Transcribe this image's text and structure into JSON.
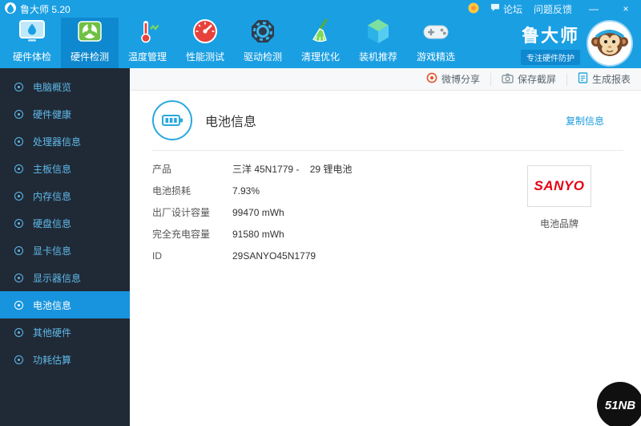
{
  "colors": {
    "accent_blue": "#1a9fe3",
    "nav_active_blue": "#0e88cf",
    "sidebar_bg": "#202a37",
    "sidebar_active_blue": "#1794dd",
    "link_blue": "#1a9bdf",
    "sanyo_red": "#e60012"
  },
  "titlebar": {
    "app_title": "鲁大师 5.20",
    "forum_label": "论坛",
    "feedback_label": "问题反馈",
    "minimize_glyph": "—",
    "close_glyph": "×"
  },
  "nav": {
    "items": [
      {
        "label": "硬件体检",
        "icon": "monitor-drop-icon",
        "active": false
      },
      {
        "label": "硬件检测",
        "icon": "gpu-fan-icon",
        "active": true
      },
      {
        "label": "温度管理",
        "icon": "thermometer-icon",
        "active": false
      },
      {
        "label": "性能测试",
        "icon": "gauge-icon",
        "active": false
      },
      {
        "label": "驱动检测",
        "icon": "gear-icon",
        "active": false
      },
      {
        "label": "清理优化",
        "icon": "broom-icon",
        "active": false
      },
      {
        "label": "装机推荐",
        "icon": "cube-icon",
        "active": false
      },
      {
        "label": "游戏精选",
        "icon": "gamepad-icon",
        "active": false
      }
    ],
    "brand": {
      "title": "鲁大师",
      "subtitle": "专注硬件防护"
    }
  },
  "toolbar": {
    "actions": [
      {
        "label": "微博分享",
        "icon": "weibo-icon"
      },
      {
        "label": "保存截屏",
        "icon": "camera-icon"
      },
      {
        "label": "生成报表",
        "icon": "report-icon"
      }
    ]
  },
  "sidebar": {
    "items": [
      {
        "label": "电脑概览",
        "active": false
      },
      {
        "label": "硬件健康",
        "active": false
      },
      {
        "label": "处理器信息",
        "active": false
      },
      {
        "label": "主板信息",
        "active": false
      },
      {
        "label": "内存信息",
        "active": false
      },
      {
        "label": "硬盘信息",
        "active": false
      },
      {
        "label": "显卡信息",
        "active": false
      },
      {
        "label": "显示器信息",
        "active": false
      },
      {
        "label": "电池信息",
        "active": true
      },
      {
        "label": "其他硬件",
        "active": false
      },
      {
        "label": "功耗估算",
        "active": false
      }
    ]
  },
  "content": {
    "title": "电池信息",
    "copy_link": "复制信息",
    "rows": [
      {
        "label": "产品",
        "value": "三洋 45N1779 -    29 锂电池"
      },
      {
        "label": "电池损耗",
        "value": "7.93%"
      },
      {
        "label": "出厂设计容量",
        "value": "99470 mWh"
      },
      {
        "label": "完全充电容量",
        "value": "91580 mWh"
      },
      {
        "label": "ID",
        "value": "29SANYO45N1779"
      }
    ],
    "battery_brand": {
      "logo_text": "SANYO",
      "caption": "电池品牌"
    }
  },
  "watermark": {
    "label": "51NB"
  }
}
